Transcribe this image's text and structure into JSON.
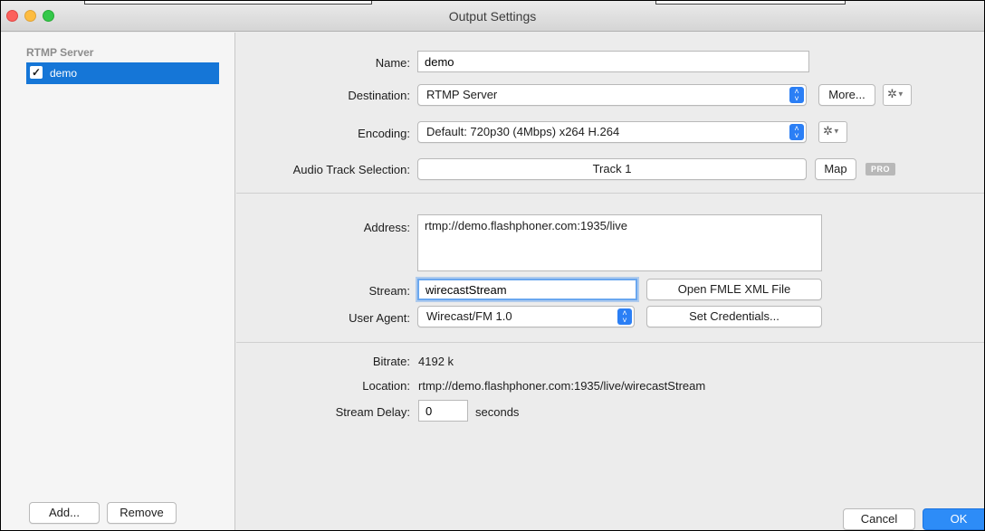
{
  "window": {
    "title": "Output Settings"
  },
  "sidebar": {
    "heading": "RTMP Server",
    "items": [
      {
        "label": "demo",
        "checked": true
      }
    ],
    "add_label": "Add...",
    "remove_label": "Remove"
  },
  "form": {
    "name_label": "Name:",
    "name_value": "demo",
    "destination_label": "Destination:",
    "destination_value": "RTMP Server",
    "more_label": "More...",
    "encoding_label": "Encoding:",
    "encoding_value": "Default: 720p30 (4Mbps) x264 H.264",
    "audio_label": "Audio Track Selection:",
    "audio_value": "Track 1",
    "map_label": "Map",
    "pro_badge": "PRO",
    "address_label": "Address:",
    "address_value": "rtmp://demo.flashphoner.com:1935/live",
    "stream_label": "Stream:",
    "stream_value": "wirecastStream",
    "open_fmle_label": "Open FMLE XML File",
    "user_agent_label": "User Agent:",
    "user_agent_value": "Wirecast/FM 1.0",
    "set_credentials_label": "Set Credentials..."
  },
  "info": {
    "bitrate_label": "Bitrate:",
    "bitrate_value": "4192 k",
    "location_label": "Location:",
    "location_value": "rtmp://demo.flashphoner.com:1935/live/wirecastStream",
    "delay_label": "Stream Delay:",
    "delay_value": "0",
    "delay_unit": "seconds"
  },
  "footer": {
    "cancel_label": "Cancel",
    "ok_label": "OK"
  },
  "colors": {
    "accent": "#1576d7",
    "ok_button": "#2d8cf7",
    "close": "#fc605c",
    "minimize": "#fdbc40",
    "maximize": "#34c84a"
  },
  "icons": {
    "gear": "gear-icon",
    "stepper": "stepper-icon",
    "checkbox": "checkbox-icon"
  }
}
